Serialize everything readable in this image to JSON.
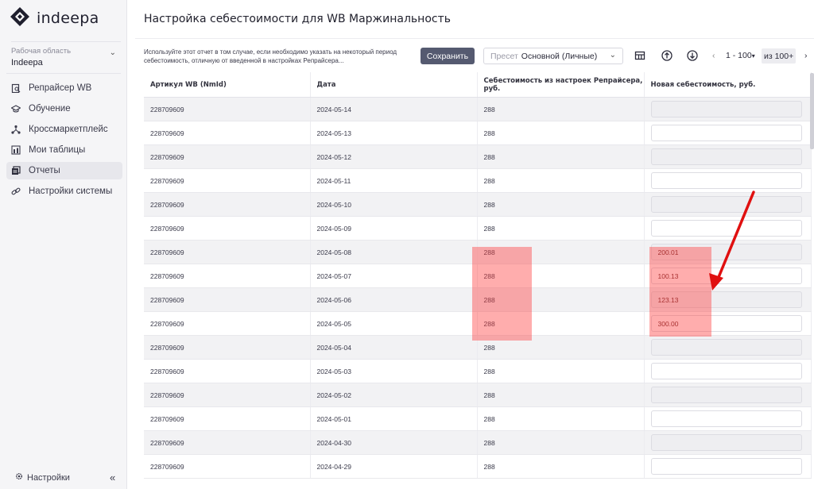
{
  "app": {
    "logo_text": "indeepa"
  },
  "workspace": {
    "label": "Рабочая область",
    "name": "Indeepa"
  },
  "nav": [
    {
      "label": "Репрайсер WB",
      "icon": "repricer-icon"
    },
    {
      "label": "Обучение",
      "icon": "graduation-cap-icon"
    },
    {
      "label": "Кроссмаркетплейс",
      "icon": "network-icon"
    },
    {
      "label": "Мои таблицы",
      "icon": "table-icon"
    },
    {
      "label": "Отчеты",
      "icon": "reports-icon",
      "active": true
    },
    {
      "label": "Настройки системы",
      "icon": "settings-link-icon"
    }
  ],
  "sidebar_footer": {
    "settings_label": "Настройки",
    "collapse_symbol": "«"
  },
  "page": {
    "title": "Настройка себестоимости для WB Маржинальность",
    "note": "Используйте этот отчет в том случае, если необходимо указать на некоторый период себестоимость, отличную от введенной в настройках Репрайсера...",
    "save_label": "Сохранить",
    "preset_label": "Пресет",
    "preset_value": "Основной (Личные)"
  },
  "pagination": {
    "prev": "‹",
    "range": "1 - 100",
    "range_chevron": "▾",
    "of_label": "из 100+",
    "next": "›"
  },
  "table": {
    "columns": [
      "Артикул WB (NmId)",
      "Дата",
      "Себестоимость из настроек Репрайсера, руб.",
      "Новая себестоимость, руб."
    ],
    "rows": [
      {
        "article": "228709609",
        "date": "2024-05-14",
        "cost": "288",
        "new_cost": ""
      },
      {
        "article": "228709609",
        "date": "2024-05-13",
        "cost": "288",
        "new_cost": ""
      },
      {
        "article": "228709609",
        "date": "2024-05-12",
        "cost": "288",
        "new_cost": ""
      },
      {
        "article": "228709609",
        "date": "2024-05-11",
        "cost": "288",
        "new_cost": ""
      },
      {
        "article": "228709609",
        "date": "2024-05-10",
        "cost": "288",
        "new_cost": ""
      },
      {
        "article": "228709609",
        "date": "2024-05-09",
        "cost": "288",
        "new_cost": ""
      },
      {
        "article": "228709609",
        "date": "2024-05-08",
        "cost": "288",
        "new_cost": "200.01"
      },
      {
        "article": "228709609",
        "date": "2024-05-07",
        "cost": "288",
        "new_cost": "100.13"
      },
      {
        "article": "228709609",
        "date": "2024-05-06",
        "cost": "288",
        "new_cost": "123.13"
      },
      {
        "article": "228709609",
        "date": "2024-05-05",
        "cost": "288",
        "new_cost": "300.00"
      },
      {
        "article": "228709609",
        "date": "2024-05-04",
        "cost": "288",
        "new_cost": ""
      },
      {
        "article": "228709609",
        "date": "2024-05-03",
        "cost": "288",
        "new_cost": ""
      },
      {
        "article": "228709609",
        "date": "2024-05-02",
        "cost": "288",
        "new_cost": ""
      },
      {
        "article": "228709609",
        "date": "2024-05-01",
        "cost": "288",
        "new_cost": ""
      },
      {
        "article": "228709609",
        "date": "2024-04-30",
        "cost": "288",
        "new_cost": ""
      },
      {
        "article": "228709609",
        "date": "2024-04-29",
        "cost": "288",
        "new_cost": ""
      }
    ]
  },
  "colors": {
    "accent": "#555a70",
    "highlight": "#ff3c3c",
    "arrow": "#e01010"
  }
}
